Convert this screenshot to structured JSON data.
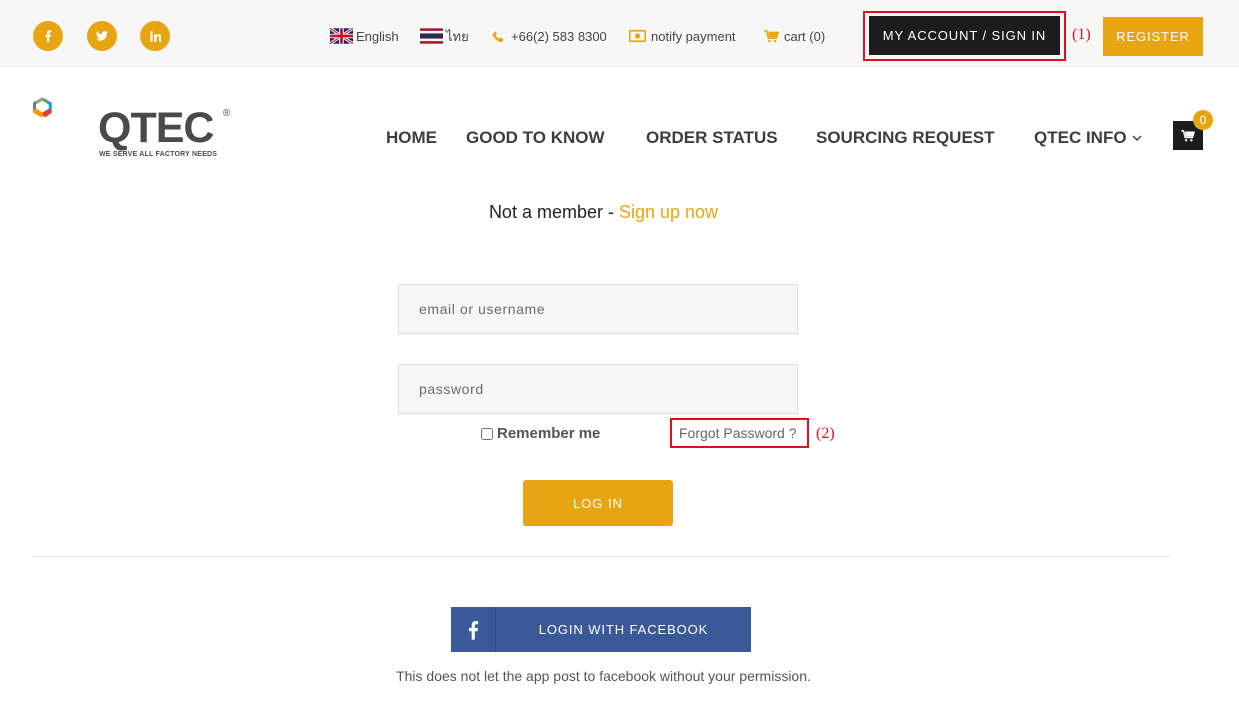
{
  "topbar": {
    "social": [
      {
        "icon": "facebook-icon"
      },
      {
        "icon": "twitter-icon"
      },
      {
        "icon": "linkedin-icon"
      }
    ],
    "lang_english": "English",
    "lang_thai": "ไทย",
    "phone": "+66(2) 583 8300",
    "notify_payment": "notify payment",
    "cart": "cart (0)",
    "signin": "MY ACCOUNT / SIGN IN",
    "annot_1": "(1)",
    "register": "REGISTER"
  },
  "logo": {
    "word": "QTEC",
    "reg": "®",
    "tagline": "WE SERVE ALL FACTORY NEEDS"
  },
  "nav": {
    "items": [
      "HOME",
      "GOOD TO KNOW",
      "ORDER STATUS",
      "SOURCING REQUEST",
      "QTEC INFO"
    ],
    "cart_count": "0"
  },
  "login": {
    "not_member": "Not a member - ",
    "signup": "Sign up now",
    "email_placeholder": "email or username",
    "password_placeholder": "password",
    "remember": "Remember me",
    "forgot": "Forgot Password ?",
    "annot_2": "(2)",
    "login_button": "LOG IN",
    "facebook_button": "LOGIN WITH FACEBOOK",
    "facebook_note": "This does not let the app post to facebook without your permission."
  },
  "colors": {
    "accent": "#e8a512",
    "dark": "#1c1c1c",
    "facebook": "#3b5998",
    "annotation": "#e0101c"
  }
}
